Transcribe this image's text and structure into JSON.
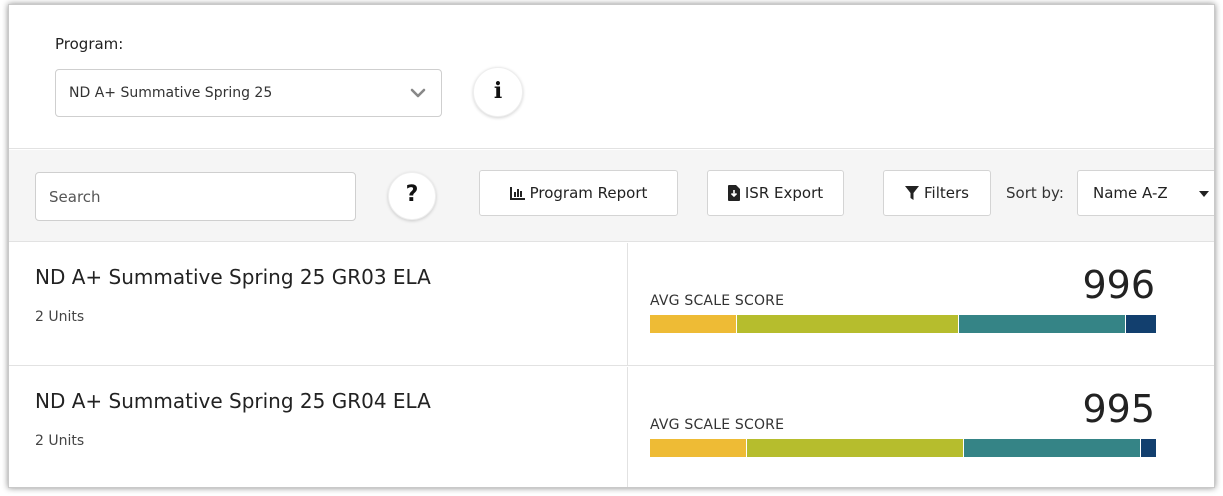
{
  "program": {
    "label": "Program:",
    "selected": "ND A+ Summative Spring 25"
  },
  "toolbar": {
    "search_placeholder": "Search",
    "help_label": "?",
    "info_label": "i",
    "program_report_label": "Program Report",
    "isr_export_label": "ISR Export",
    "filters_label": "Filters",
    "sort_label": "Sort by:",
    "sort_value": "Name A-Z"
  },
  "rows": [
    {
      "title": "ND A+ Summative Spring 25 GR03 ELA",
      "units": "2 Units",
      "avg_label": "AVG SCALE SCORE",
      "score": "996",
      "distribution": [
        0.17,
        0.44,
        0.33,
        0.06
      ]
    },
    {
      "title": "ND A+ Summative Spring 25 GR04 ELA",
      "units": "2 Units",
      "avg_label": "AVG SCALE SCORE",
      "score": "995",
      "distribution": [
        0.19,
        0.43,
        0.35,
        0.03
      ]
    }
  ],
  "colors": {
    "level_1": "#eebb35",
    "level_2": "#b6bd2d",
    "level_3": "#358486",
    "level_4": "#123f6e"
  },
  "icons": [
    "chevron-down-icon",
    "info-icon",
    "question-icon",
    "bar-chart-icon",
    "file-download-icon",
    "filter-icon",
    "caret-down-icon"
  ]
}
